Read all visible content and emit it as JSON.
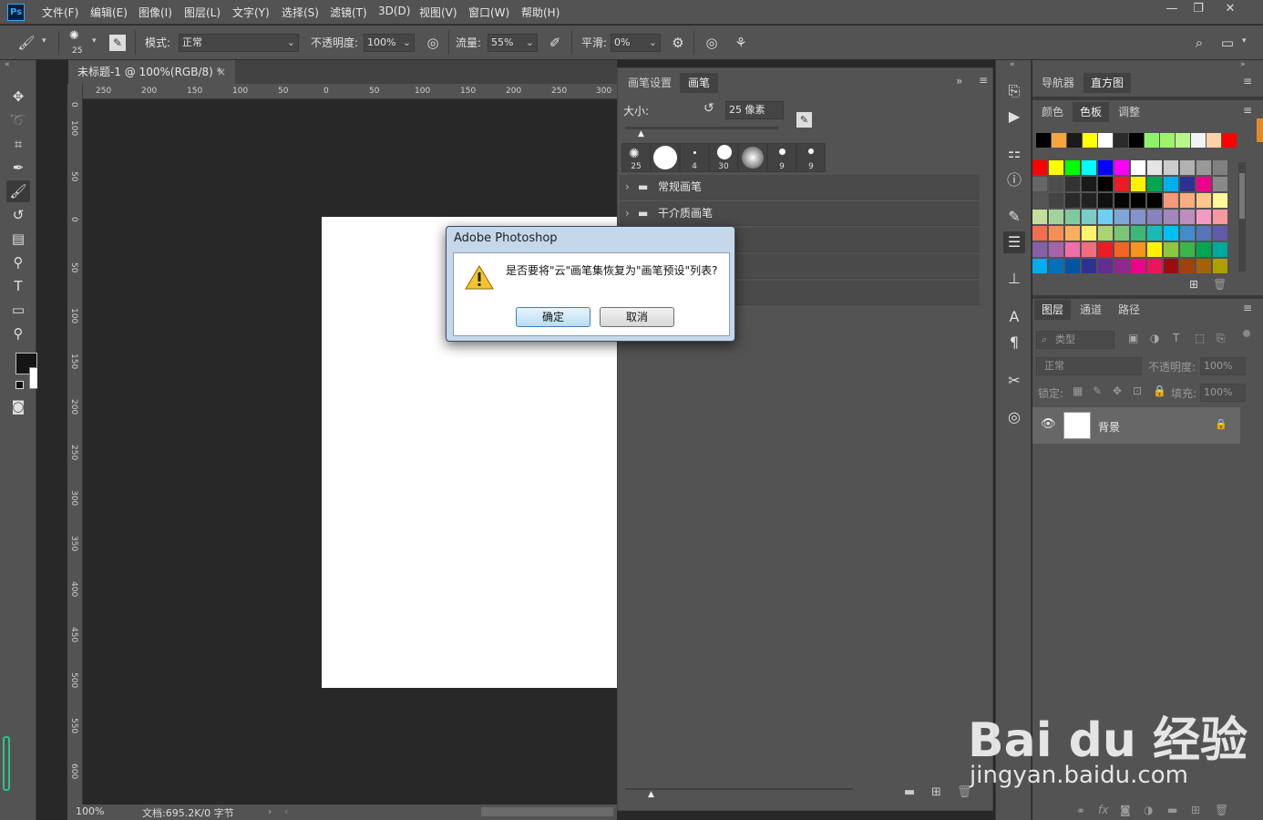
{
  "menubar": {
    "logo": "Ps",
    "items": [
      "文件(F)",
      "编辑(E)",
      "图像(I)",
      "图层(L)",
      "文字(Y)",
      "选择(S)",
      "滤镜(T)",
      "3D(D)",
      "视图(V)",
      "窗口(W)",
      "帮助(H)"
    ],
    "window_controls": [
      "—",
      "❐",
      "✕"
    ]
  },
  "options": {
    "brush_size": "25",
    "mode_label": "模式:",
    "mode_value": "正常",
    "opacity_label": "不透明度:",
    "opacity_value": "100%",
    "flow_label": "流量:",
    "flow_value": "55%",
    "smooth_label": "平滑:",
    "smooth_value": "0%"
  },
  "document": {
    "tab_title": "未标题-1 @ 100%(RGB/8) *",
    "tab_close": "×",
    "hruler_labels": [
      "250",
      "200",
      "150",
      "100",
      "50",
      "0",
      "50",
      "100",
      "150",
      "200",
      "250",
      "300"
    ],
    "vruler_labels": [
      "0",
      "100",
      "50",
      "0",
      "50",
      "100",
      "150",
      "200",
      "250",
      "300",
      "350",
      "400",
      "450",
      "500",
      "550",
      "600"
    ],
    "zoom": "100%",
    "doc_info": "文档:695.2K/0 字节"
  },
  "brush_panel": {
    "tabs": [
      "画笔设置",
      "画笔"
    ],
    "size_label": "大小:",
    "size_value": "25 像素",
    "thumbs": [
      "25",
      "",
      "4",
      "30",
      "",
      "9",
      "9"
    ],
    "groups": [
      "常规画笔",
      "干介质画笔"
    ]
  },
  "right_panels": {
    "top_tabs": [
      "导航器",
      "直方图"
    ],
    "swatch_tabs": [
      "颜色",
      "色板",
      "调整"
    ],
    "layer_tabs": [
      "图层",
      "通道",
      "路径"
    ],
    "filter_placeholder": "类型",
    "blend_mode": "正常",
    "opacity_label": "不透明度:",
    "opacity_value": "100%",
    "lock_label": "锁定:",
    "fill_label": "填充:",
    "fill_value": "100%",
    "layer_name": "背景",
    "recent_swatches": [
      "#000000",
      "#f7a541",
      "#1a1a1a",
      "#ffff00",
      "#ffffff",
      "#2b2b2b",
      "#000000",
      "#8ef26b",
      "#9ff36a",
      "#b8f58a",
      "#f3f3f3",
      "#ffd3a8",
      "#ff0000"
    ],
    "swatch_grid": [
      [
        "#ff0000",
        "#ffff00",
        "#00ff00",
        "#00ffff",
        "#0000ff",
        "#ff00ff",
        "#ffffff",
        "#e5e5e5",
        "#cccccc",
        "#b2b2b2",
        "#999999",
        "#808080"
      ],
      [
        "#666666",
        "#4d4d4d",
        "#333333",
        "#1a1a1a",
        "#000000",
        "#ed1c24",
        "#fff200",
        "#00a651",
        "#00aeef",
        "#2e3192",
        "#ec008c",
        "#898989"
      ],
      [
        "#555555",
        "#444444",
        "#2a2a2a",
        "#222222",
        "#111111",
        "#050505",
        "#000000",
        "#000000",
        "#f7977a",
        "#f9ad81",
        "#fdc68a",
        "#fff79a"
      ],
      [
        "#c4df9b",
        "#a3d39c",
        "#82ca9d",
        "#7bcdc8",
        "#6ecff6",
        "#7ea7d8",
        "#8493ca",
        "#8882be",
        "#a187be",
        "#bc8dbf",
        "#f49ac2",
        "#f6989d"
      ],
      [
        "#f26c4f",
        "#f68e55",
        "#fbaf5c",
        "#fff467",
        "#acd372",
        "#7cc576",
        "#3bb878",
        "#1abbb4",
        "#00bff3",
        "#438ccb",
        "#5574b9",
        "#605ca8"
      ],
      [
        "#855fa8",
        "#a763a8",
        "#f06ea9",
        "#f26d7d",
        "#ed1c24",
        "#f26522",
        "#f7941d",
        "#fff200",
        "#8dc63f",
        "#39b54a",
        "#00a651",
        "#00a99d"
      ],
      [
        "#00aeef",
        "#0072bc",
        "#0054a6",
        "#2e3192",
        "#662d91",
        "#92278f",
        "#ec008c",
        "#ed145b",
        "#9e0b0f",
        "#a0410d",
        "#a36209",
        "#aba000"
      ]
    ]
  },
  "dialog": {
    "title": "Adobe Photoshop",
    "message": "是否要将\"云\"画笔集恢复为\"画笔预设\"列表?",
    "ok": "确定",
    "cancel": "取消"
  },
  "watermark": {
    "logo": "Bai du 经验",
    "url": "jingyan.baidu.com"
  }
}
